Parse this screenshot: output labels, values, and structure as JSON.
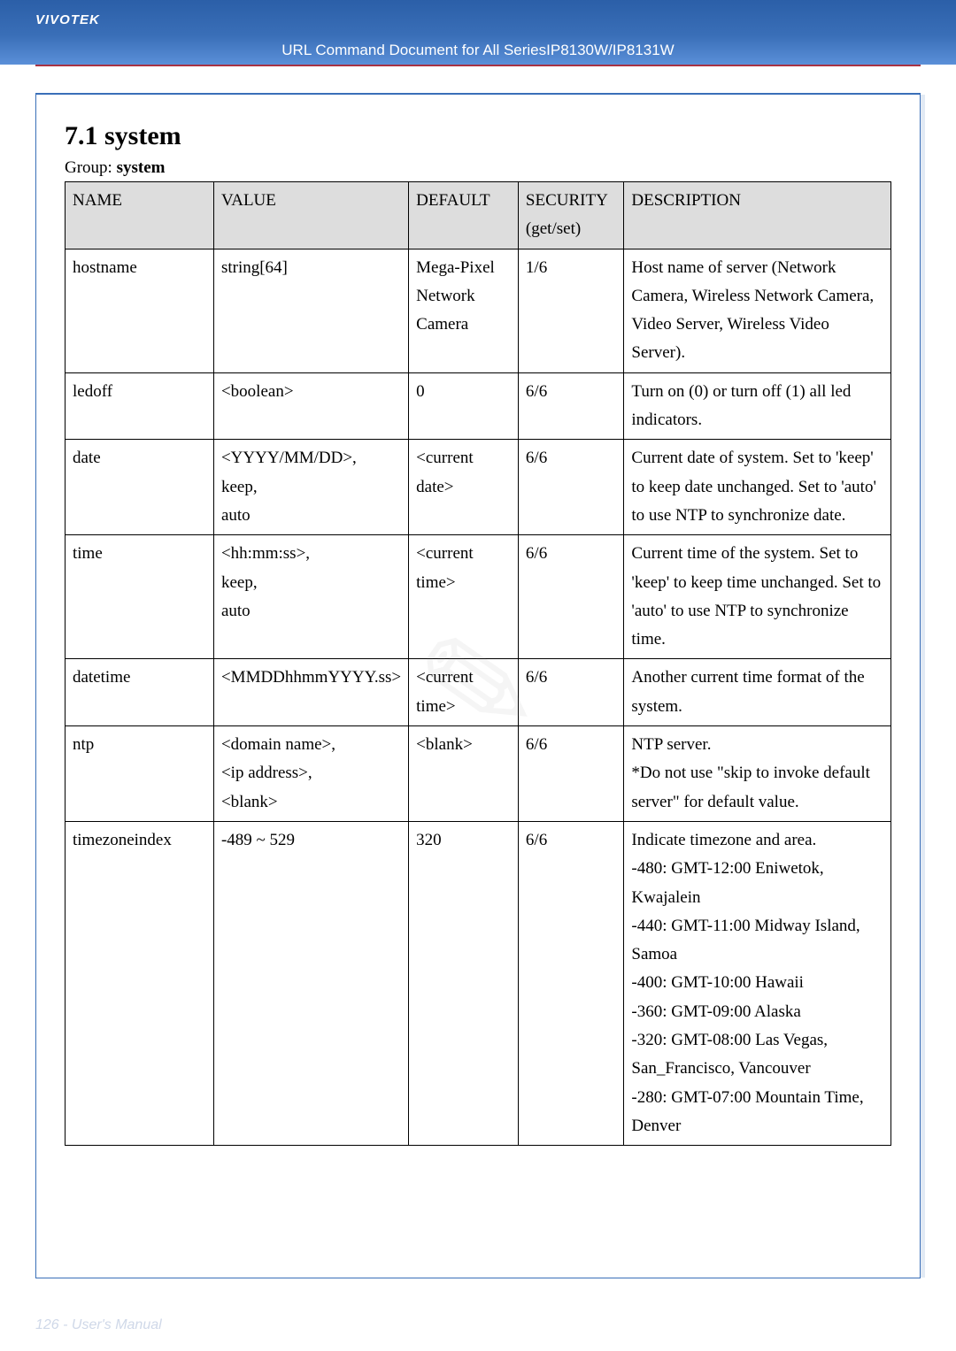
{
  "brand": "VIVOTEK",
  "doc_title": "URL Command Document for All SeriesIP8130W/IP8131W",
  "heading": "7.1 system",
  "group_lbl": "Group: ",
  "group_val": "system",
  "hdr": {
    "name": "NAME",
    "value": "VALUE",
    "default": "DEFAULT",
    "security": "SECURITY",
    "security2": "(get/set)",
    "desc": "DESCRIPTION"
  },
  "rows": [
    {
      "name": "hostname",
      "value": "string[64]",
      "default": "Mega-Pixel Network Camera",
      "security": "1/6",
      "desc": "Host name of server (Network Camera, Wireless Network Camera, Video Server, Wireless Video Server)."
    },
    {
      "name": "ledoff",
      "value": "<boolean>",
      "default": "0",
      "security": "6/6",
      "desc": "Turn on (0) or turn off (1) all led indicators."
    },
    {
      "name": "date",
      "value": "<YYYY/MM/DD>,\nkeep,\nauto",
      "default": "<current date>",
      "security": "6/6",
      "desc": "Current date of system. Set to 'keep' to keep date unchanged. Set to 'auto' to use NTP to synchronize date."
    },
    {
      "name": "time",
      "value": "<hh:mm:ss>,\nkeep,\nauto",
      "default": "<current time>",
      "security": "6/6",
      "desc": "Current time of the system. Set to 'keep' to keep time unchanged. Set to 'auto' to use NTP to synchronize time."
    },
    {
      "name": "datetime",
      "value": "<MMDDhhmmYYYY.ss>",
      "default": "<current time>",
      "security": "6/6",
      "desc": "Another current time format of the system."
    },
    {
      "name": "ntp",
      "value": "<domain name>,\n<ip address>,\n<blank>",
      "default": "<blank>",
      "security": "6/6",
      "desc": "NTP server.\n*Do not use \"skip to invoke default server\" for default value."
    },
    {
      "name": "timezoneindex",
      "value": "-489 ~ 529",
      "default": "320",
      "security": "6/6",
      "desc": "Indicate timezone and area.\n-480: GMT-12:00 Eniwetok, Kwajalein\n-440: GMT-11:00 Midway Island, Samoa\n-400: GMT-10:00 Hawaii\n-360: GMT-09:00 Alaska\n-320: GMT-08:00 Las Vegas, San_Francisco, Vancouver\n-280: GMT-07:00 Mountain Time, Denver"
    }
  ],
  "footer": "126 - User's Manual",
  "chart_data": {
    "type": "table",
    "title": "7.1 system — Group: system",
    "columns": [
      "NAME",
      "VALUE",
      "DEFAULT",
      "SECURITY (get/set)",
      "DESCRIPTION"
    ],
    "rows": [
      [
        "hostname",
        "string[64]",
        "Mega-Pixel Network Camera",
        "1/6",
        "Host name of server (Network Camera, Wireless Network Camera, Video Server, Wireless Video Server)."
      ],
      [
        "ledoff",
        "<boolean>",
        "0",
        "6/6",
        "Turn on (0) or turn off (1) all led indicators."
      ],
      [
        "date",
        "<YYYY/MM/DD>, keep, auto",
        "<current date>",
        "6/6",
        "Current date of system. Set to 'keep' to keep date unchanged. Set to 'auto' to use NTP to synchronize date."
      ],
      [
        "time",
        "<hh:mm:ss>, keep, auto",
        "<current time>",
        "6/6",
        "Current time of the system. Set to 'keep' to keep time unchanged. Set to 'auto' to use NTP to synchronize time."
      ],
      [
        "datetime",
        "<MMDDhhmmYYYY.ss>",
        "<current time>",
        "6/6",
        "Another current time format of the system."
      ],
      [
        "ntp",
        "<domain name>, <ip address>, <blank>",
        "<blank>",
        "6/6",
        "NTP server. *Do not use \"skip to invoke default server\" for default value."
      ],
      [
        "timezoneindex",
        "-489 ~ 529",
        "320",
        "6/6",
        "Indicate timezone and area. -480: GMT-12:00 Eniwetok, Kwajalein; -440: GMT-11:00 Midway Island, Samoa; -400: GMT-10:00 Hawaii; -360: GMT-09:00 Alaska; -320: GMT-08:00 Las Vegas, San_Francisco, Vancouver; -280: GMT-07:00 Mountain Time, Denver"
      ]
    ]
  }
}
